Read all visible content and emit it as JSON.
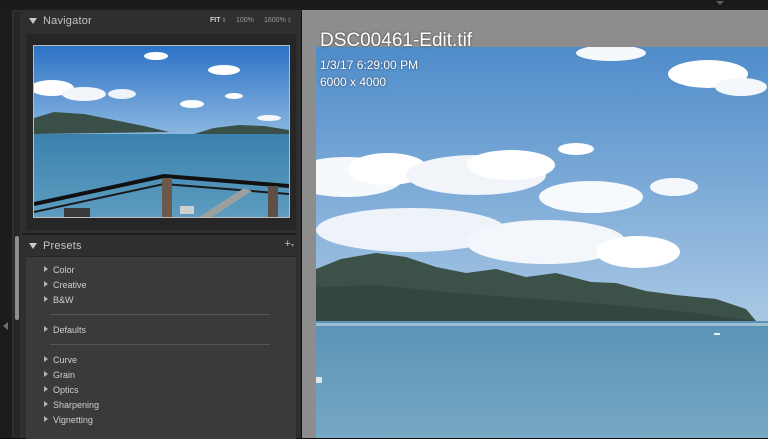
{
  "navigator": {
    "title": "Navigator",
    "zoom_options": [
      {
        "label": "FIT",
        "has_menu": true,
        "active": true
      },
      {
        "label": "100%",
        "has_menu": false,
        "active": false
      },
      {
        "label": "1600%",
        "has_menu": true,
        "active": false
      }
    ]
  },
  "presets": {
    "title": "Presets",
    "add_label": "+",
    "groups": [
      {
        "items": [
          "Color",
          "Creative",
          "B&W"
        ]
      },
      {
        "items": [
          "Defaults"
        ]
      },
      {
        "items": [
          "Curve",
          "Grain",
          "Optics",
          "Sharpening",
          "Vignetting"
        ]
      }
    ]
  },
  "photo_info": {
    "filename": "DSC00461-Edit.tif",
    "datetime": "1/3/17 6:29:00 PM",
    "dimensions": "6000 x 4000"
  },
  "colors": {
    "panel_bg": "#2f2f2f",
    "canvas_bg": "#8d8d8d",
    "sky": "#5f95cc",
    "water": "#6a99b4",
    "mountain": "#3d5248"
  }
}
